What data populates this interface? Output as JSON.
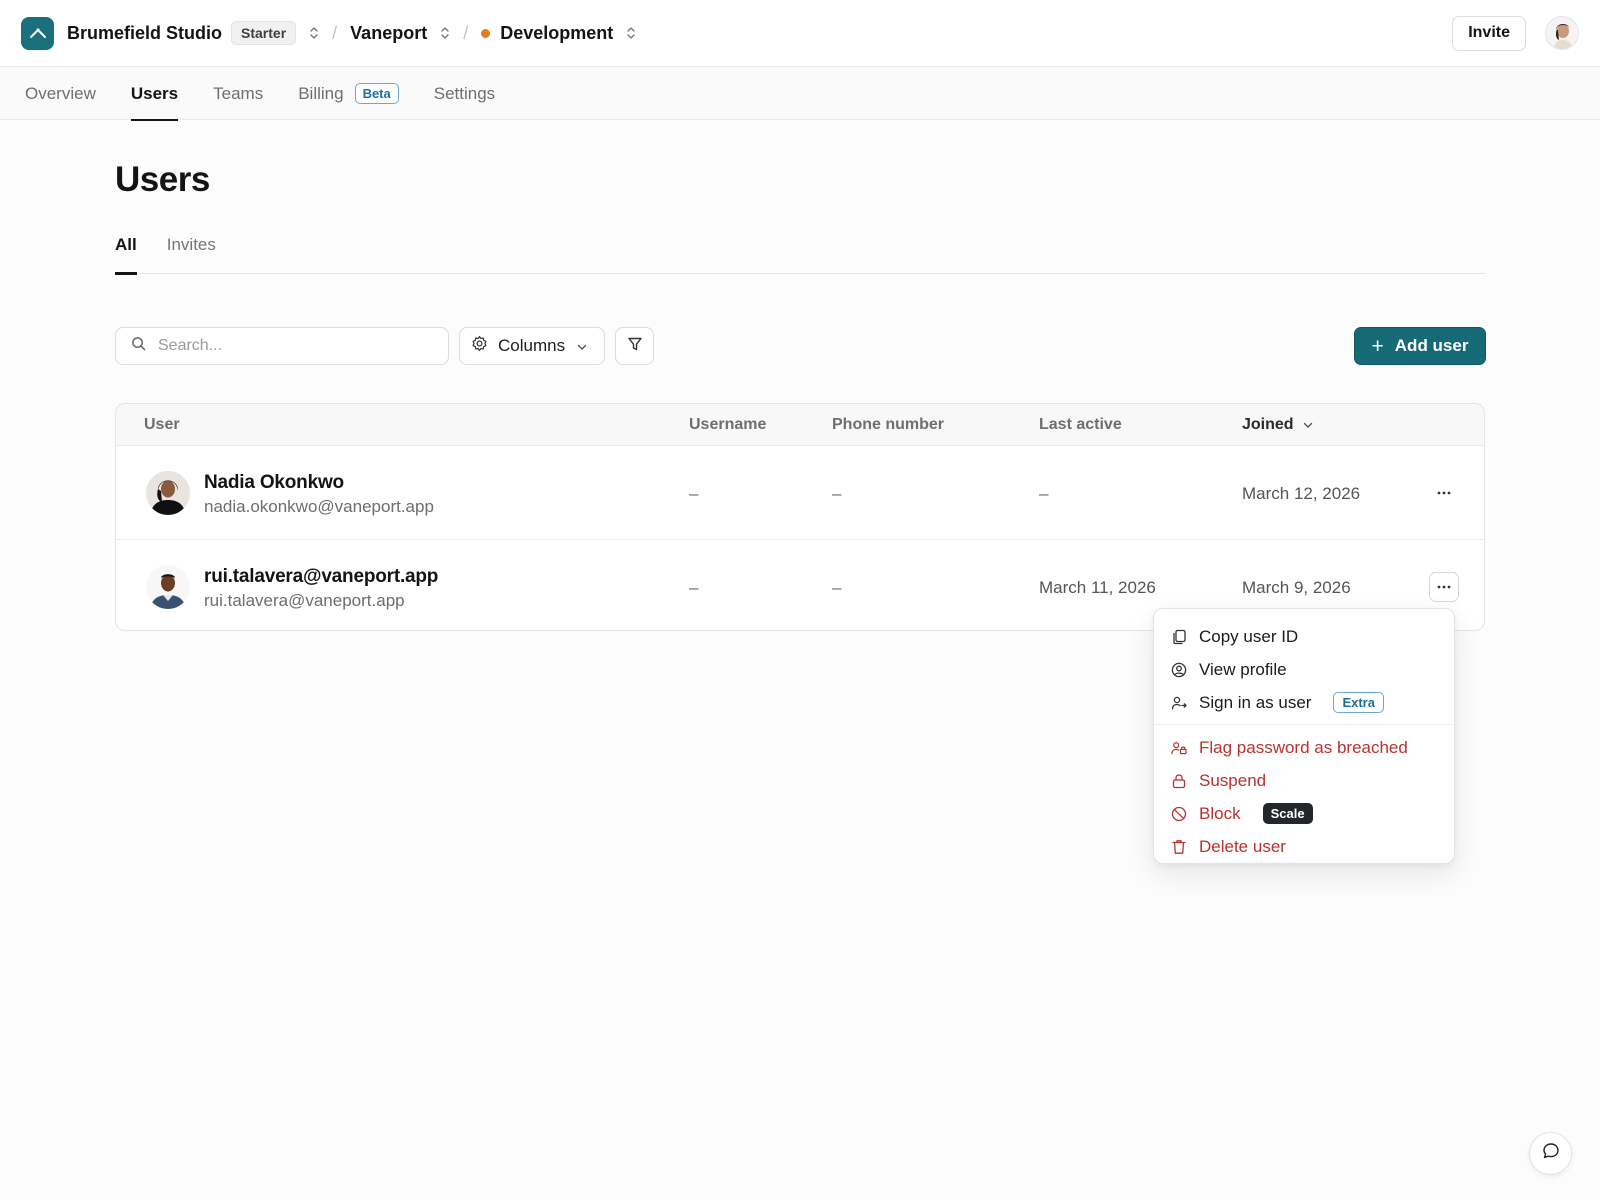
{
  "header": {
    "org_name": "Brumefield Studio",
    "plan": "Starter",
    "breadcrumb_separator": "/",
    "project": "Vaneport",
    "environment": "Development",
    "environment_dot_color": "#e47c1a",
    "invite_label": "Invite"
  },
  "nav": {
    "tabs": [
      {
        "label": "Overview",
        "active": false
      },
      {
        "label": "Users",
        "active": true
      },
      {
        "label": "Teams",
        "active": false
      },
      {
        "label": "Billing",
        "active": false,
        "badge": "Beta"
      },
      {
        "label": "Settings",
        "active": false
      }
    ]
  },
  "page": {
    "title": "Users",
    "subtabs": [
      {
        "label": "All",
        "active": true
      },
      {
        "label": "Invites",
        "active": false
      }
    ]
  },
  "toolbar": {
    "search_placeholder": "Search...",
    "columns_label": "Columns",
    "add_user_label": "Add user",
    "add_user_plus": "+"
  },
  "table": {
    "columns": {
      "user": "User",
      "username": "Username",
      "phone": "Phone number",
      "last_active": "Last active",
      "joined": "Joined"
    },
    "rows": [
      {
        "name": "Nadia Okonkwo",
        "email": "nadia.okonkwo@vaneport.app",
        "username": "–",
        "phone": "–",
        "last_active": "–",
        "joined": "March 12, 2026",
        "menu_open": false
      },
      {
        "name": "rui.talavera@vaneport.app",
        "email": "rui.talavera@vaneport.app",
        "username": "–",
        "phone": "–",
        "last_active": "March 11, 2026",
        "joined": "March 9, 2026",
        "menu_open": true
      }
    ]
  },
  "row_menu": {
    "items": [
      {
        "label": "Copy user ID",
        "icon": "copy-icon",
        "danger": false
      },
      {
        "label": "View profile",
        "icon": "user-circle-icon",
        "danger": false
      },
      {
        "label": "Sign in as user",
        "icon": "user-sign-in-icon",
        "danger": false,
        "badge": "Extra"
      },
      {
        "label": "Flag password as breached",
        "icon": "user-lock-icon",
        "danger": true
      },
      {
        "label": "Suspend",
        "icon": "lock-icon",
        "danger": true
      },
      {
        "label": "Block",
        "icon": "block-icon",
        "danger": true,
        "badge": "Scale"
      },
      {
        "label": "Delete user",
        "icon": "trash-icon",
        "danger": true
      }
    ]
  },
  "colors": {
    "accent": "#156a76",
    "danger": "#b8322e",
    "badge_blue": "#1d6e9c"
  }
}
